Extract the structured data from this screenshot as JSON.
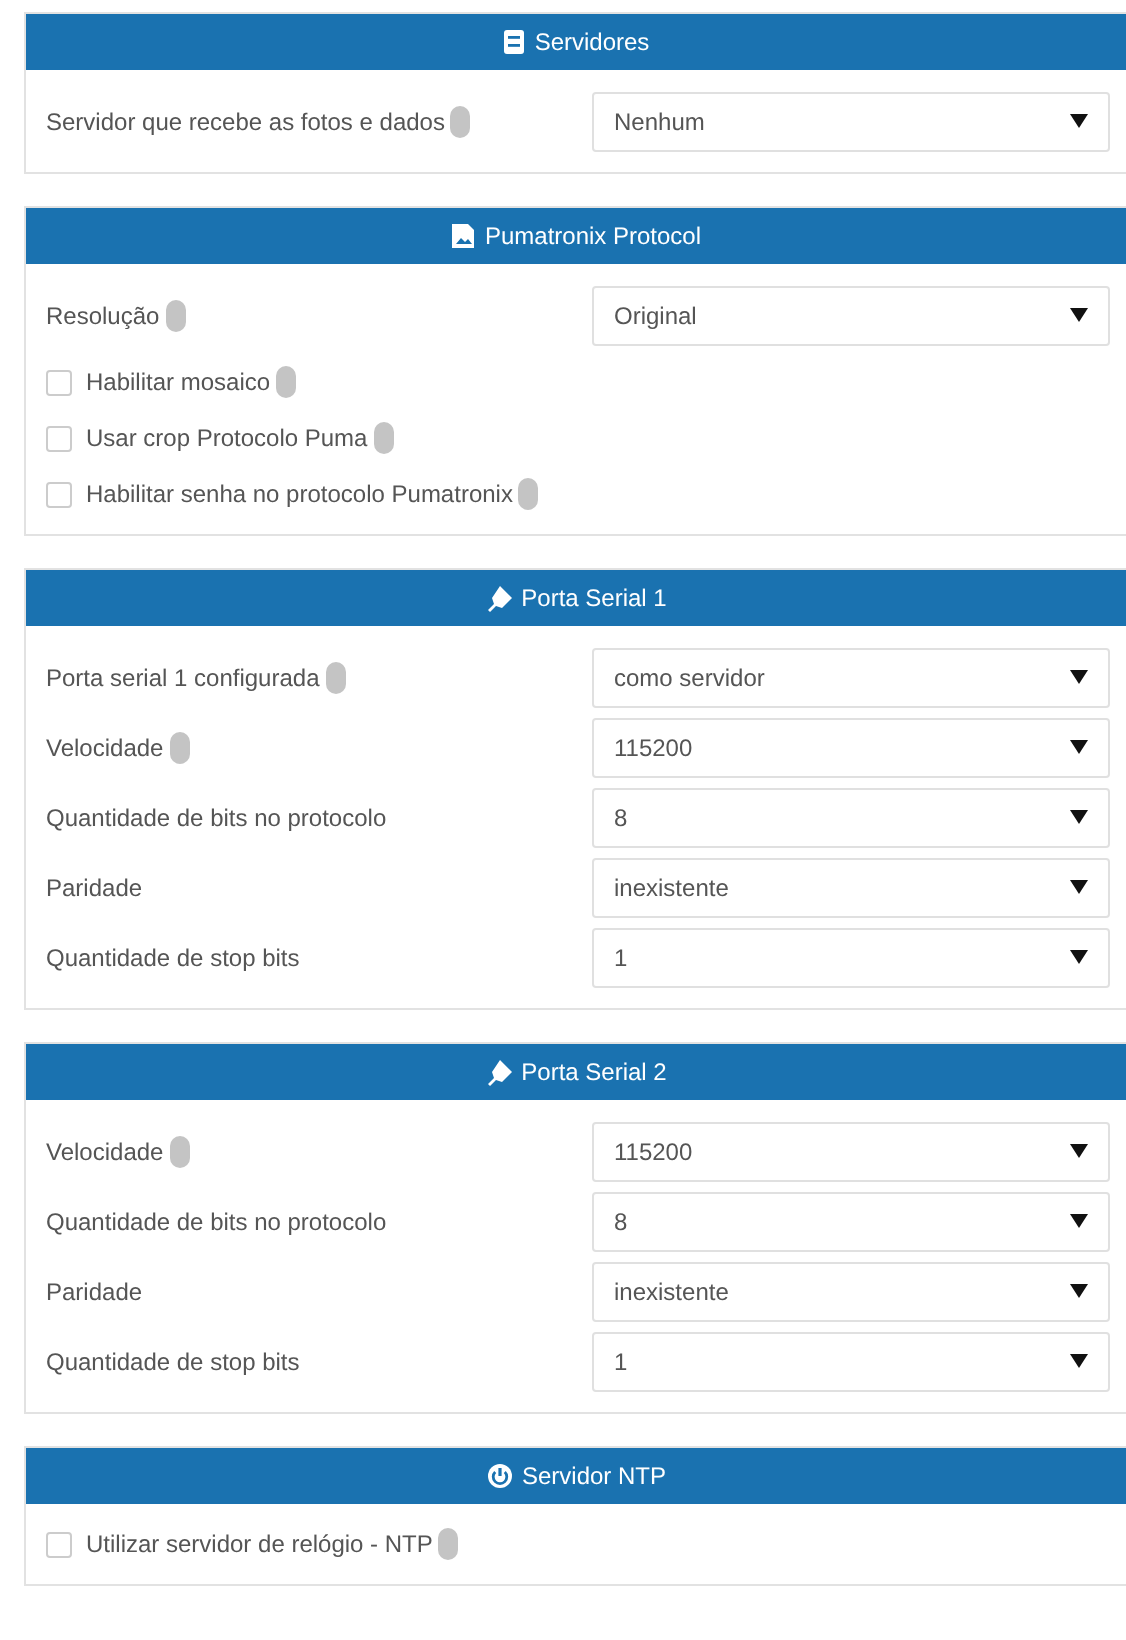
{
  "panels": [
    {
      "title": "Servidores",
      "rows": [
        {
          "kind": "select",
          "label": "Servidor que recebe as fotos e dados",
          "help": true,
          "value": "Nenhum"
        }
      ]
    },
    {
      "title": "Pumatronix Protocol",
      "rows": [
        {
          "kind": "select",
          "label": "Resolução",
          "help": true,
          "value": "Original"
        },
        {
          "kind": "checkbox",
          "label": "Habilitar mosaico",
          "help": true,
          "checked": false
        },
        {
          "kind": "checkbox",
          "label": "Usar crop Protocolo Puma",
          "help": true,
          "checked": false
        },
        {
          "kind": "checkbox",
          "label": "Habilitar senha no protocolo Pumatronix",
          "help": true,
          "checked": false
        }
      ]
    },
    {
      "title": "Porta Serial 1",
      "rows": [
        {
          "kind": "select",
          "label": "Porta serial 1 configurada",
          "help": true,
          "value": "como servidor"
        },
        {
          "kind": "select",
          "label": "Velocidade",
          "help": true,
          "value": "115200"
        },
        {
          "kind": "select",
          "label": "Quantidade de bits no protocolo",
          "help": false,
          "value": "8"
        },
        {
          "kind": "select",
          "label": "Paridade",
          "help": false,
          "value": "inexistente"
        },
        {
          "kind": "select",
          "label": "Quantidade de stop bits",
          "help": false,
          "value": "1"
        }
      ]
    },
    {
      "title": "Porta Serial 2",
      "rows": [
        {
          "kind": "select",
          "label": "Velocidade",
          "help": true,
          "value": "115200"
        },
        {
          "kind": "select",
          "label": "Quantidade de bits no protocolo",
          "help": false,
          "value": "8"
        },
        {
          "kind": "select",
          "label": "Paridade",
          "help": false,
          "value": "inexistente"
        },
        {
          "kind": "select",
          "label": "Quantidade de stop bits",
          "help": false,
          "value": "1"
        }
      ]
    },
    {
      "title": "Servidor NTP",
      "rows": [
        {
          "kind": "checkbox",
          "label": "Utilizar servidor de relógio - NTP",
          "help": true,
          "checked": false
        }
      ]
    }
  ]
}
